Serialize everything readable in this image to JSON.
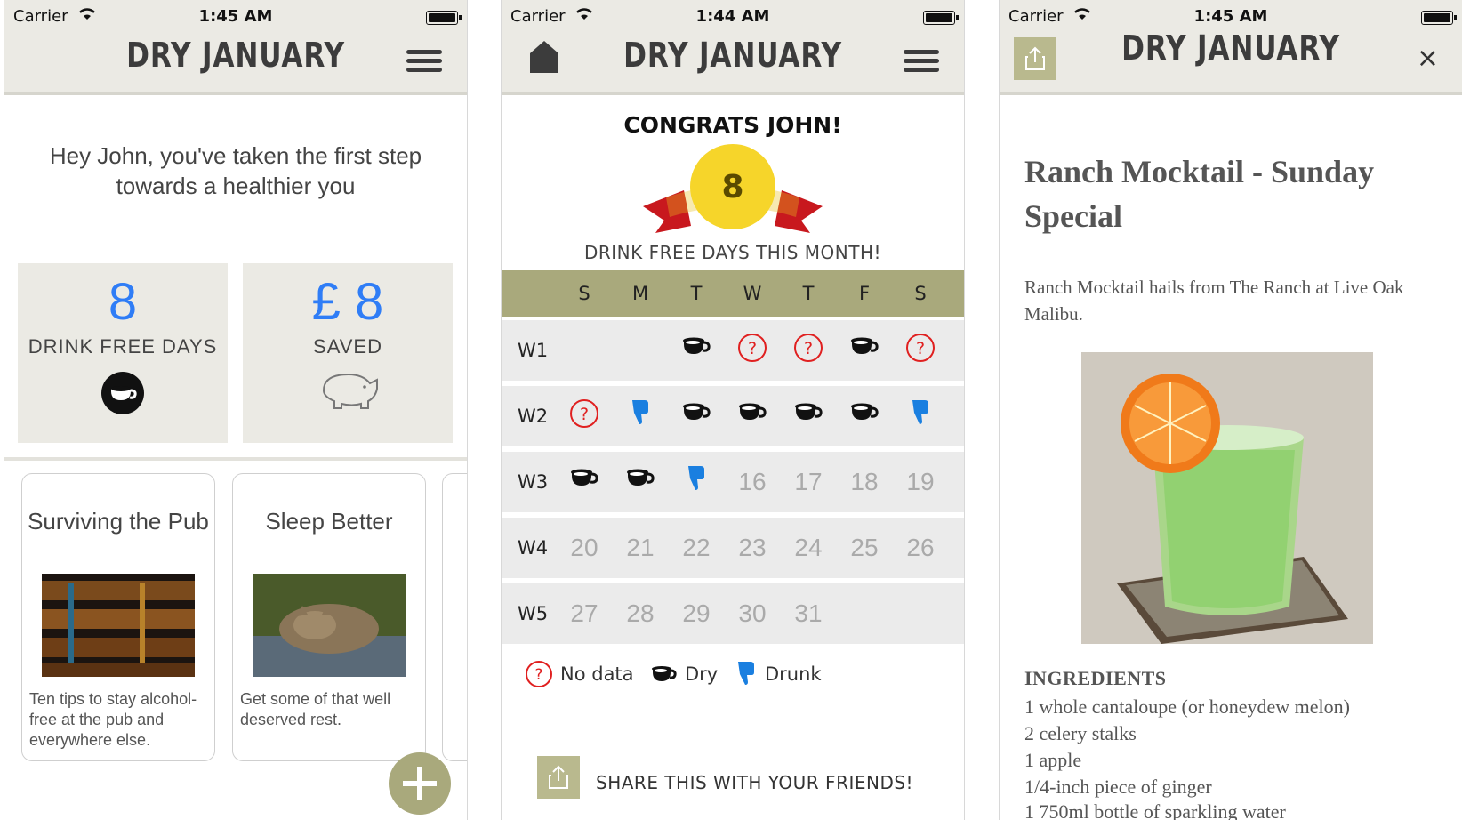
{
  "status": {
    "carrier": "Carrier"
  },
  "screen1": {
    "time": "1:45 AM",
    "title": "DRY JANUARY",
    "greeting_line1": "Hey John, you've taken the first step",
    "greeting_line2": "towards a healthier you",
    "stat1": {
      "value": "8",
      "label": "DRINK FREE DAYS"
    },
    "stat2": {
      "value": "£ 8",
      "label": "SAVED"
    },
    "cards": [
      {
        "title": "Surviving the Pub",
        "desc": "Ten tips to stay alcohol-free at the pub and everywhere else."
      },
      {
        "title": "Sleep Better",
        "desc": "Get some of that well deserved rest."
      }
    ]
  },
  "screen2": {
    "time": "1:44 AM",
    "title": "DRY JANUARY",
    "congrats": "CONGRATS JOHN!",
    "badge_value": "8",
    "month_label": "DRINK FREE DAYS THIS MONTH!",
    "days": [
      "S",
      "M",
      "T",
      "W",
      "T",
      "F",
      "S"
    ],
    "weeks": [
      {
        "label": "W1",
        "cells": [
          "",
          "",
          "dry",
          "nodata",
          "nodata",
          "dry",
          "nodata"
        ]
      },
      {
        "label": "W2",
        "cells": [
          "nodata",
          "drunk",
          "dry",
          "dry",
          "dry",
          "dry",
          "drunk"
        ]
      },
      {
        "label": "W3",
        "cells": [
          "dry",
          "dry",
          "drunk",
          "16",
          "17",
          "18",
          "19"
        ]
      },
      {
        "label": "W4",
        "cells": [
          "20",
          "21",
          "22",
          "23",
          "24",
          "25",
          "26"
        ]
      },
      {
        "label": "W5",
        "cells": [
          "27",
          "28",
          "29",
          "30",
          "31",
          "",
          ""
        ]
      }
    ],
    "legend": {
      "nodata": "No data",
      "dry": "Dry",
      "drunk": "Drunk"
    },
    "share": "SHARE THIS WITH YOUR FRIENDS!"
  },
  "screen3": {
    "time": "1:45 AM",
    "title": "DRY JANUARY",
    "close": "×",
    "recipe_title": "Ranch Mocktail - Sunday Special",
    "recipe_desc": "Ranch Mocktail hails from The Ranch at Live Oak Malibu.",
    "ingredients_heading": "INGREDIENTS",
    "ingredients": [
      "1 whole cantaloupe (or honeydew melon)",
      "2 celery stalks",
      "1 apple",
      "1/4-inch piece of ginger",
      "1 750ml bottle of sparkling water"
    ]
  },
  "colors": {
    "accent": "#2f7df6",
    "olive": "#a9a97c",
    "red": "#e02020",
    "drunk_blue": "#1a7fe0"
  }
}
